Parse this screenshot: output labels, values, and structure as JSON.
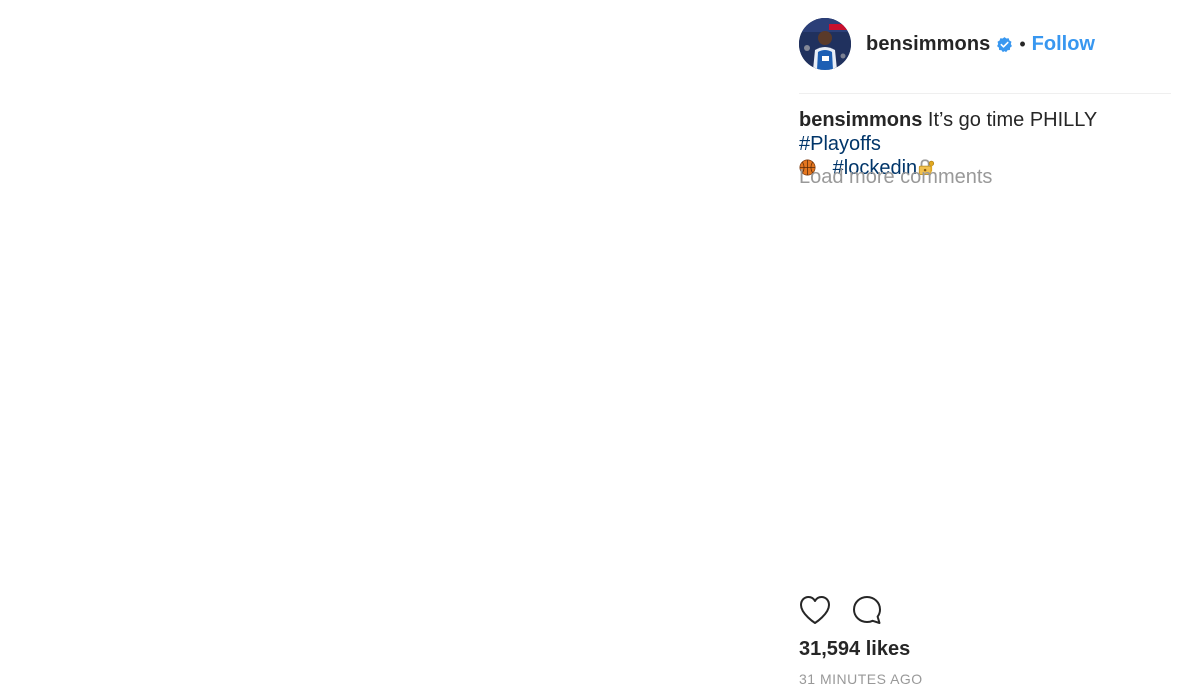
{
  "post": {
    "username": "bensimmons",
    "verified_icon": "verified-badge-icon",
    "separator": "•",
    "follow_label": "Follow",
    "caption": {
      "username": "bensimmons",
      "text": "It’s go time PHILLY",
      "hashtag_1": "#Playoffs",
      "emoji_1": "basketball-icon",
      "hashtag_2": "#lockedin",
      "emoji_2": "lock-with-key-icon"
    },
    "load_more_label": "Load more comments",
    "actions": {
      "like_icon": "heart-icon",
      "comment_icon": "comment-bubble-icon"
    },
    "likes_text": "31,594 likes",
    "timestamp": "31 MINUTES AGO"
  },
  "colors": {
    "text": "#262626",
    "link_blue": "#3897f0",
    "hashtag_blue": "#003569",
    "muted_gray": "#999999",
    "divider": "#efefef"
  }
}
